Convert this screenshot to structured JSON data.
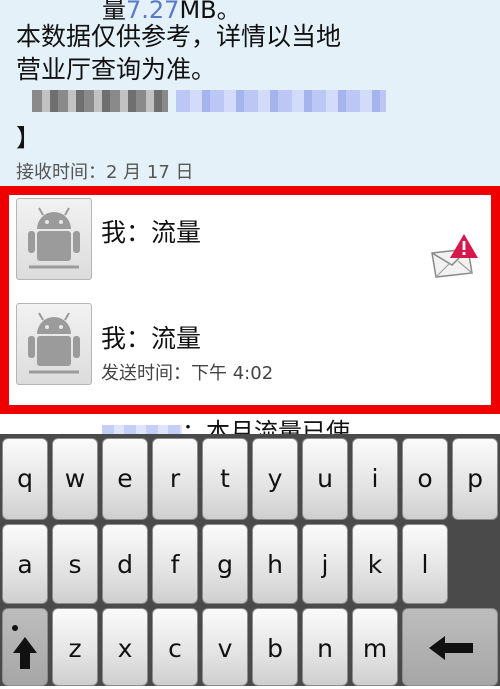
{
  "received": {
    "top_line": {
      "prefix": "量",
      "link": "7.27",
      "suffix": "MB。"
    },
    "body_lines": [
      "本数据仅供参考，详情以当地",
      "营业厅查询为准。"
    ],
    "close_bracket": "】",
    "time": "接收时间：2 月 17 日"
  },
  "thread": {
    "failed_message": {
      "sender": "我：流量",
      "status_icon": "mail-warning-icon"
    },
    "sent_message": {
      "sender": "我：流量",
      "time": "发送时间：下午 4:02"
    },
    "next_preview": "：本月流量已使"
  },
  "colors": {
    "highlight": "#ee0000",
    "received_bg": "#e4f1f9",
    "warning": "#d6174b",
    "link": "#5a79c9"
  },
  "keyboard": {
    "row1": [
      "q",
      "w",
      "e",
      "r",
      "t",
      "y",
      "u",
      "i",
      "o",
      "p"
    ],
    "row2": [
      "a",
      "s",
      "d",
      "f",
      "g",
      "h",
      "j",
      "k",
      "l"
    ],
    "row3": [
      "z",
      "x",
      "c",
      "v",
      "b",
      "n",
      "m"
    ],
    "shift_icon": "shift-arrow-icon",
    "delete_icon": "backspace-arrow-icon"
  }
}
